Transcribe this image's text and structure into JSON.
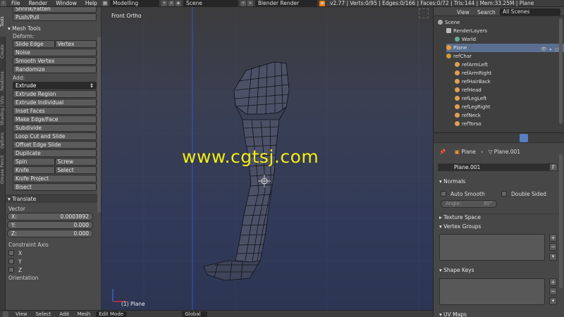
{
  "topbar": {
    "menus": [
      "File",
      "Render",
      "Window",
      "Help"
    ],
    "screen_layout": "Modelling",
    "scene": "Scene",
    "render_engine": "Blender Render",
    "stats": "v2.77 | Verts:0/95 | Edges:0/166 | Faces:0/72 | Tris:144 | Mem:33.25M | Plane"
  },
  "toolshelf": {
    "tabs": [
      "Tools",
      "Create",
      "Relations",
      "Shading / UVs",
      "Options",
      "Grease Pencil"
    ],
    "top_buttons": [
      "Shrink/Fatten",
      "Push/Pull"
    ],
    "mesh_tools_header": "Mesh Tools",
    "deform_label": "Deform:",
    "slide_edge": "Slide Edge",
    "vertex": "Vertex",
    "noise": "Noise",
    "smooth_vertex": "Smooth Vertex",
    "randomize": "Randomize",
    "add_label": "Add:",
    "extrude": "Extrude",
    "add_buttons": [
      "Extrude Region",
      "Extrude Individual",
      "Inset Faces",
      "Make Edge/Face",
      "Subdivide",
      "Loop Cut and Slide",
      "Offset Edge Slide",
      "Duplicate"
    ],
    "spin": "Spin",
    "screw": "Screw",
    "knife": "Knife",
    "select": "Select",
    "knife_project": "Knife Project",
    "bisect": "Bisect",
    "translate_header": "Translate",
    "vector_label": "Vector",
    "x_label": "X:",
    "x_value": "0.0003892",
    "y_label": "Y:",
    "y_value": "0.000",
    "z_label": "Z:",
    "z_value": "0.000",
    "constraint_label": "Constraint Axis",
    "constraint_x": "X",
    "constraint_y": "Y",
    "constraint_z": "Z",
    "orientation_label": "Orientation"
  },
  "viewport": {
    "view_name": "Front Ortho",
    "object_name": "(1) Plane",
    "watermark": "www.cgtsj.com"
  },
  "bottombar": {
    "menus": [
      "View",
      "Select",
      "Add",
      "Mesh"
    ],
    "mode": "Edit Mode",
    "orientation": "Global"
  },
  "outliner": {
    "menus": [
      "View",
      "Search"
    ],
    "filter": "All Scenes",
    "items": [
      "Scene",
      "RenderLayers",
      "World",
      "Plane",
      "refChar",
      "refArmLeft",
      "refArmRight",
      "refHairBack",
      "refHead",
      "refLegLeft",
      "refLegRight",
      "refNeck",
      "refTorso"
    ]
  },
  "properties": {
    "breadcrumb_object": "Plane",
    "breadcrumb_data": "Plane.001",
    "data_name": "Plane.001",
    "fake_user": "F",
    "normals_header": "Normals",
    "auto_smooth": "Auto Smooth",
    "double_sided": "Double Sided",
    "angle_label": "Angle:",
    "angle_value": "30°",
    "texture_space": "Texture Space",
    "vertex_groups": "Vertex Groups",
    "shape_keys": "Shape Keys",
    "uv_maps": "UV Maps"
  },
  "colors": {
    "active_orange": "#f29a34",
    "selected_blue": "#5680c2",
    "viewport_blue": "#2f3857",
    "mesh_fill": "#4b5068",
    "watermark_yellow": "#f3ee10"
  }
}
